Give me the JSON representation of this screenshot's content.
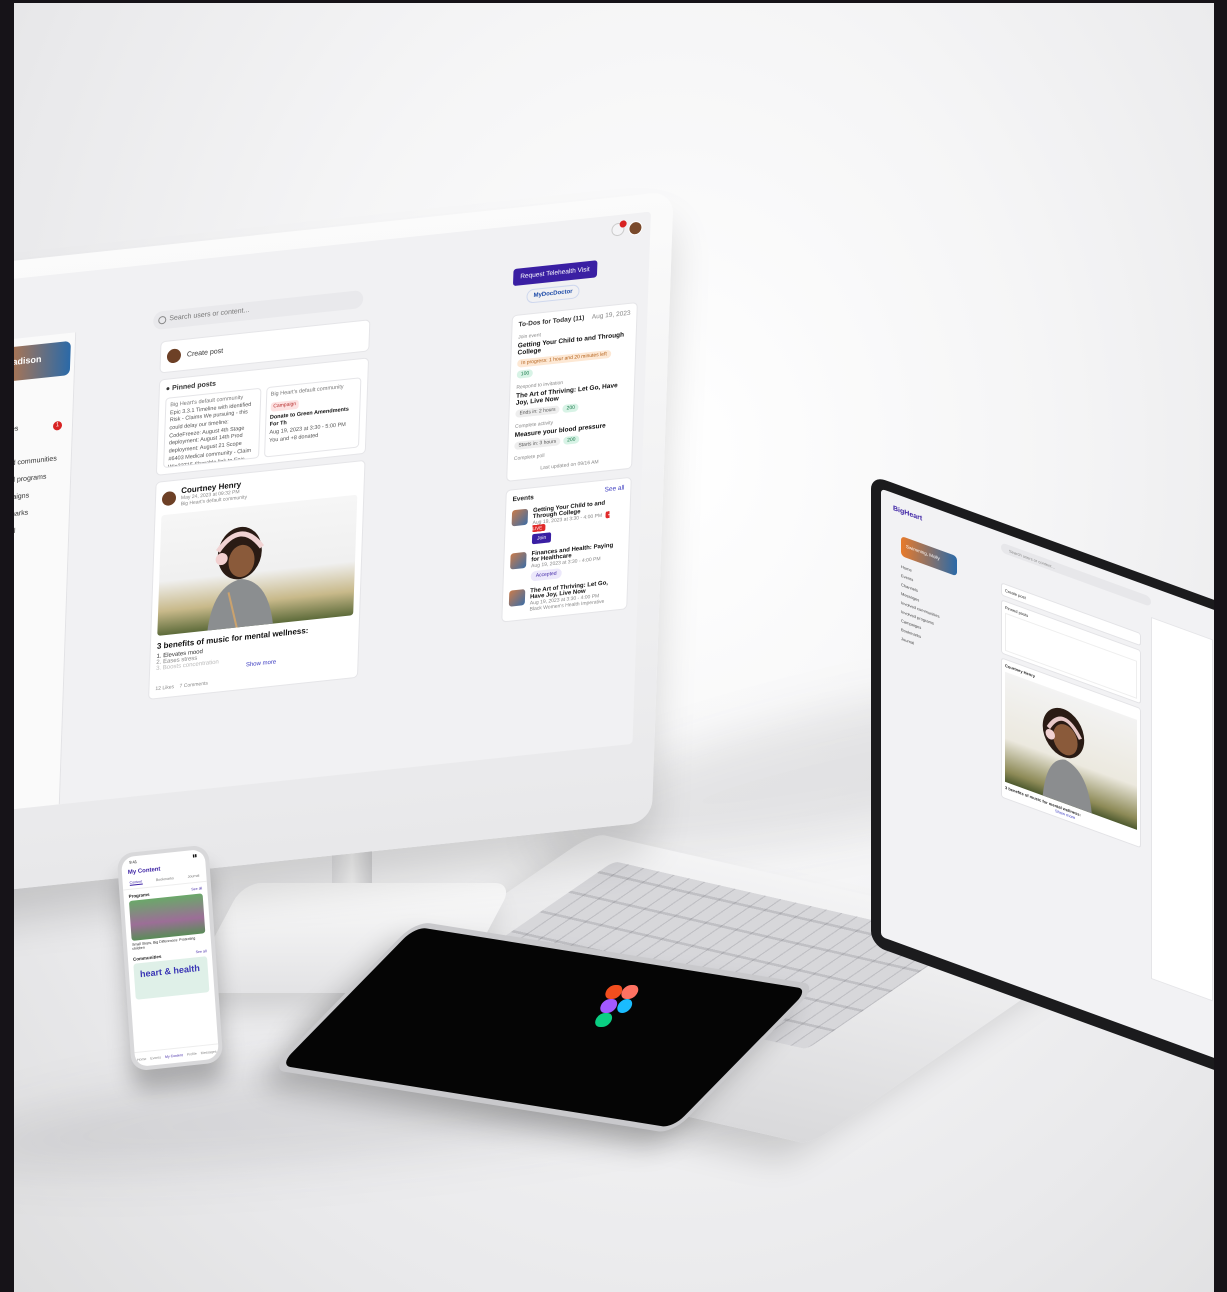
{
  "monitor": {
    "sidebar": {
      "cover_name": "g, Madison",
      "items": [
        "s",
        "eets",
        "ssages",
        "ict",
        "nolved communities",
        "nolved programs",
        "Campaigns",
        "Bookmarks",
        "Journal"
      ],
      "messages_badge": "1"
    },
    "search": {
      "placeholder": "Search users or content..."
    },
    "create_post": "Create post",
    "pinned": {
      "label": "Pinned posts",
      "post1": {
        "community": "Big Heart's default community",
        "body": "Epic 3.3.1 Timeline with identified Risk - Claims We pursuing - this could delay our timeline: CodeFreeze: August 4th Stage deployment: August 14th Prod deployment: August 21 Scope #6403 Medical community - Claim Wio33715 Sharable link to Epic 5..."
      },
      "post2": {
        "community": "Big Heart's default community",
        "tag": "Campaign",
        "title": "Donate to Green Amendments For Th",
        "date": "Aug 19, 2023 at 3:30 - 5:00 PM",
        "donated": "You and +8 donated"
      }
    },
    "post": {
      "author": "Courtney Henry",
      "date": "May 24, 2023 at 09:32 PM",
      "community": "Big Heart's default community",
      "title": "3 benefits of music for mental wellness:",
      "list": [
        "1. Elevates mood",
        "2. Eases stress",
        "3. Boosts concentration"
      ],
      "show_more": "Show more",
      "likes": "12 Likes",
      "comments": "7 Comments"
    },
    "right": {
      "telehealth_button": "Request Telehealth Visit",
      "partner_logo": "MyDocDoctor",
      "todos": {
        "title": "To-Dos for Today (11)",
        "date": "Aug 19, 2023",
        "items": [
          {
            "label": "Join event",
            "title": "Getting Your Child to and Through College",
            "pill": "In progress: 1 hour and 20 minutes left",
            "points": "100"
          },
          {
            "label": "Respond to invitation",
            "title": "The Art of Thriving: Let Go, Have Joy, Live Now",
            "pill": "Ends in: 2 hours",
            "points": "200"
          },
          {
            "label": "Complete activity",
            "title": "Measure your blood pressure",
            "pill": "Starts in: 3 hours",
            "points": "200"
          },
          {
            "label": "Complete poll",
            "title": "",
            "pill": "",
            "points": ""
          }
        ],
        "updated": "Last updated on 09/16 AM"
      },
      "events": {
        "title": "Events",
        "see_all": "See all",
        "items": [
          {
            "title": "Getting Your Child to and Through College",
            "date": "Aug 19, 2023 at 3:30 - 4:00 PM",
            "badge": "• LIVE",
            "action": "Join"
          },
          {
            "title": "Finances and Health: Paying for Healthcare",
            "date": "Aug 19, 2023 at 3:30 - 4:00 PM",
            "badge": "",
            "action": "Accepted"
          },
          {
            "title": "The Art of Thriving: Let Go, Have Joy, Live Now",
            "date": "Aug 19, 2023 at 3:30 - 4:00 PM",
            "badge": "",
            "action": "Black Women's Health Imperative"
          }
        ]
      }
    }
  },
  "laptop": {
    "logo": "BigHeart",
    "cover_name": "Swimming, Molly",
    "search": "Search users or content...",
    "create_post": "Create post",
    "sidebar": [
      "Home",
      "Events",
      "Channels",
      "Messages",
      "Involved communities",
      "Involved programs",
      "Campaigns",
      "Bookmarks",
      "Journal"
    ],
    "pinned_label": "Pinned posts",
    "post_author": "Courtney Henry",
    "post_title": "3 benefits of music for mental wellness:",
    "show_more": "Show more"
  },
  "phone": {
    "time": "9:41",
    "title": "My Content",
    "tabs": [
      "Content",
      "Bookmarks",
      "Journal"
    ],
    "programs_label": "Programs",
    "programs_see_all": "See all",
    "program_caption": "Small Steps, Big Differences: Protecting children",
    "communities_label": "Communities",
    "communities_see_all": "See all",
    "community_brand": "heart & health",
    "nav": [
      "Home",
      "Events",
      "My Content",
      "Profile",
      "Messages"
    ]
  },
  "colors": {
    "brand_purple": "#3a1fa3",
    "live_red": "#e12a2a",
    "figma_red": "#f24e1e",
    "figma_purple": "#a259ff",
    "figma_blue": "#1abcfe",
    "figma_green": "#0acf83",
    "figma_orange": "#ff7262"
  }
}
